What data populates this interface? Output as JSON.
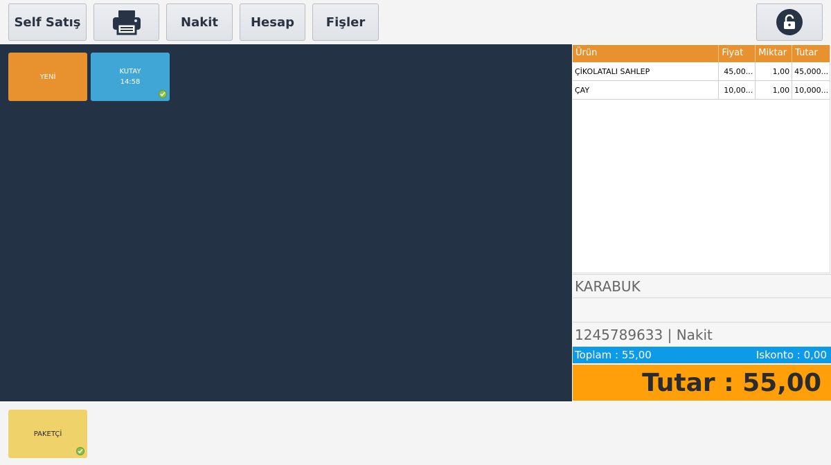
{
  "toolbar": {
    "self_label": "Self Satış",
    "print_icon": "printer-icon",
    "nakit_label": "Nakit",
    "hesap_label": "Hesap",
    "fisler_label": "Fişler",
    "lock_icon": "unlock-icon"
  },
  "tables": [
    {
      "name": "YENİ",
      "time": "",
      "color": "#e8912f"
    },
    {
      "name": "KUTAY",
      "time": "14:58",
      "color": "#3fa6d6",
      "status_icon": "check-icon"
    }
  ],
  "order": {
    "headers": [
      "Ürün",
      "Fiyat",
      "Miktar",
      "Tutar"
    ],
    "rows": [
      {
        "urun": "ÇİKOLATALI SAHLEP",
        "fiyat": "45,00...",
        "miktar": "1,00",
        "tutar": "45,000..."
      },
      {
        "urun": "ÇAY",
        "fiyat": "10,00...",
        "miktar": "1,00",
        "tutar": "10,000..."
      }
    ]
  },
  "customer": {
    "city": "KARABUK",
    "address": "",
    "phone_payment": "1245789633 | Nakit"
  },
  "summary": {
    "toplam": "Toplam : 55,00",
    "iskonto": "Iskonto : 0,00",
    "tutar": "Tutar : 55,00"
  },
  "bottom": {
    "paket_label": "PAKETÇİ",
    "status_icon": "check-icon"
  },
  "colors": {
    "dark_bg": "#233345",
    "accent_orange": "#e8912f",
    "accent_blue": "#0d9ae6",
    "total_orange": "#ff9f0a",
    "paket_yellow": "#f0d26b"
  }
}
